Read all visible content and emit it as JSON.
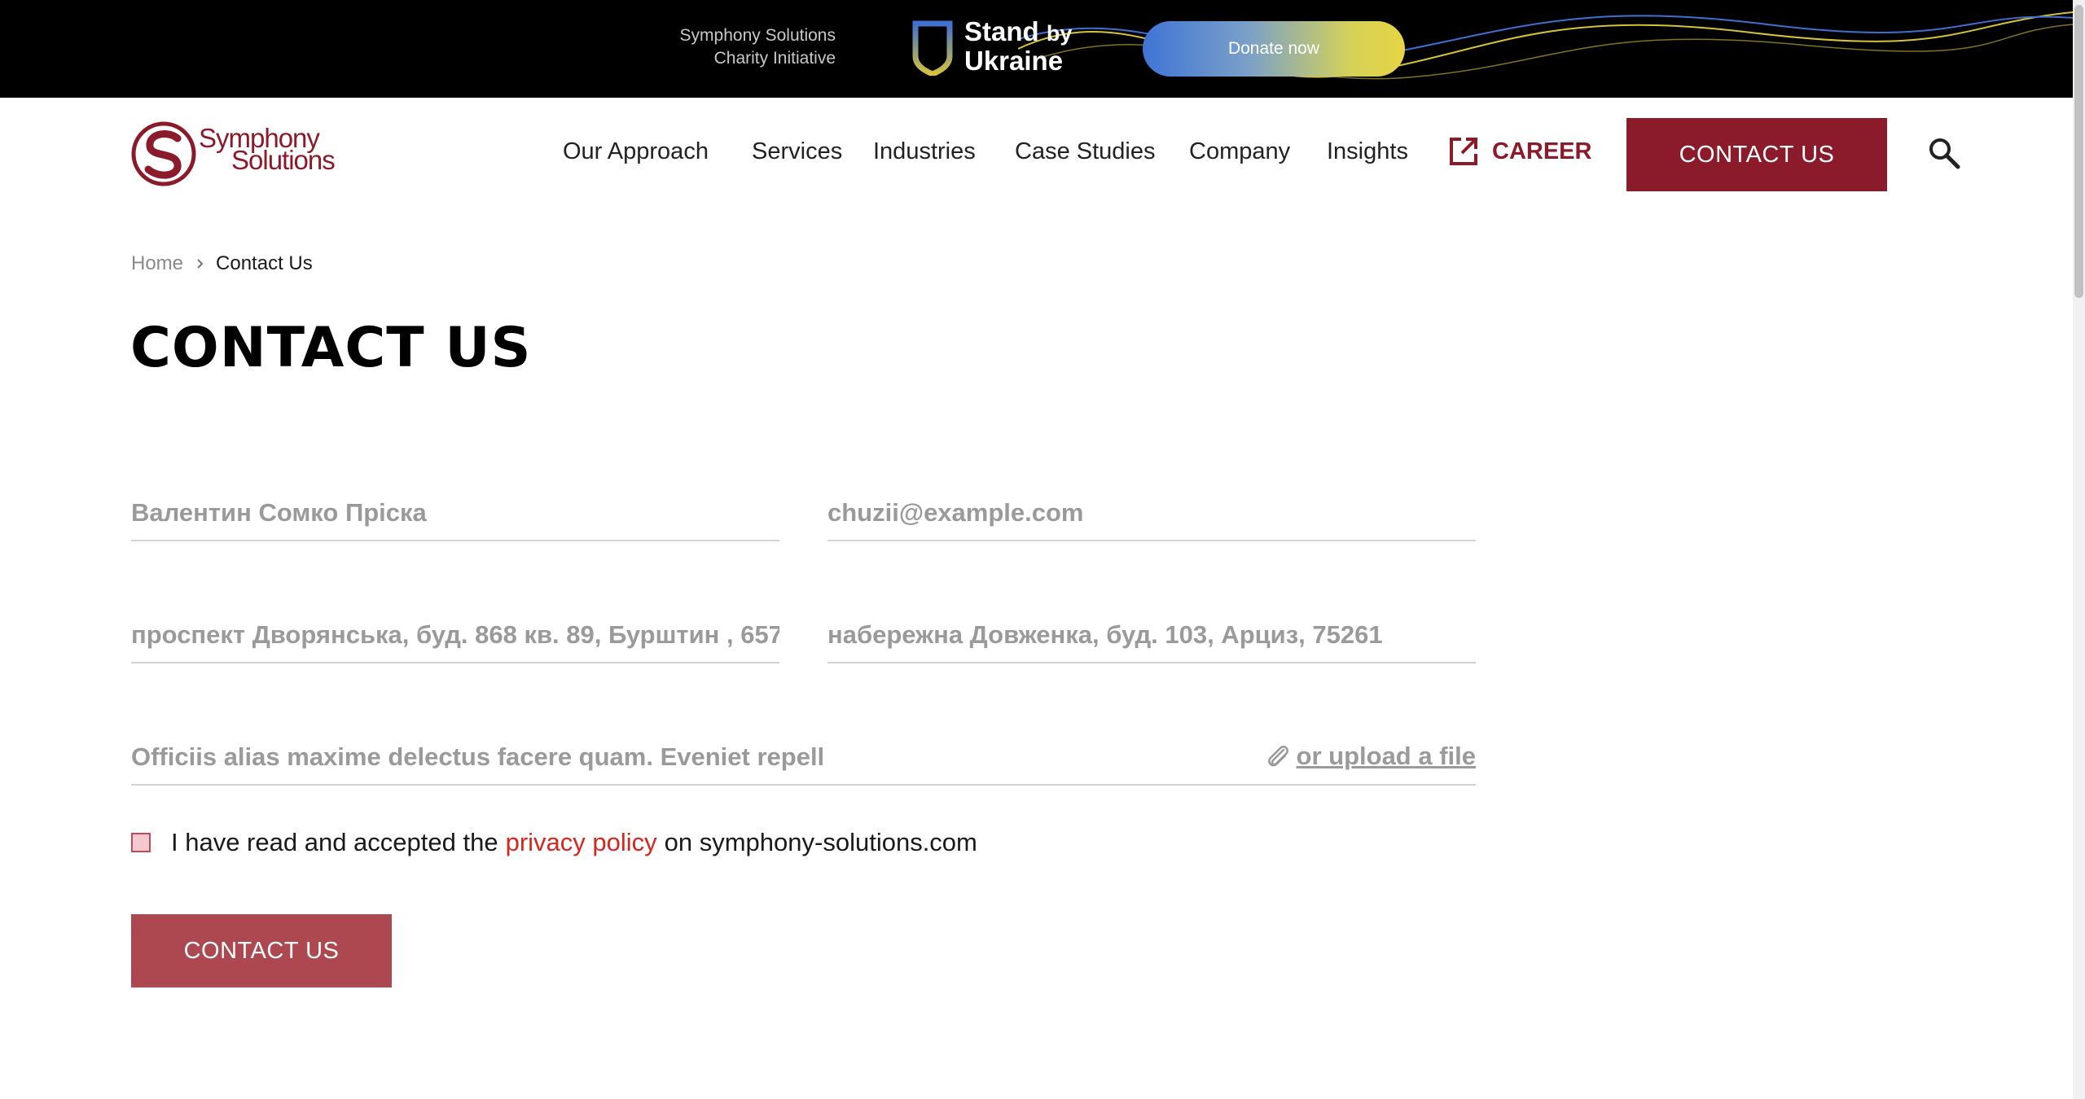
{
  "banner": {
    "charity_line1": "Symphony Solutions",
    "charity_line2": "Charity Initiative",
    "stand_line1": "Stand",
    "stand_by": "by",
    "stand_line2": "Ukraine",
    "donate_label": "Donate now"
  },
  "header": {
    "logo_line1": "Symphony",
    "logo_line2": "Solutions",
    "nav": {
      "approach": "Our Approach",
      "services": "Services",
      "industries": "Industries",
      "case_studies": "Case Studies",
      "company": "Company",
      "insights": "Insights",
      "career": "CAREER"
    },
    "contact_label": "CONTACT US"
  },
  "breadcrumb": {
    "home": "Home",
    "current": "Contact Us"
  },
  "page_title": "CONTACT US",
  "form": {
    "name_value": "Валентин Сомко Пріска",
    "email_value": "chuzii@example.com",
    "address1_value": "проспект Дворянська, буд. 868 кв. 89, Бурштин , 657",
    "address2_value": "набережна Довженка, буд. 103, Арциз, 75261",
    "message_value": "Officiis alias maxime delectus facere quam. Eveniet repell",
    "upload_label": "or upload a file",
    "consent_prefix": "I have read and accepted the",
    "privacy_link": "privacy policy",
    "consent_suffix": "on symphony-solutions.com",
    "submit_label": "CONTACT US"
  },
  "colors": {
    "brand": "#8b1a2b",
    "submit": "#ae4850",
    "link": "#d7261e"
  }
}
